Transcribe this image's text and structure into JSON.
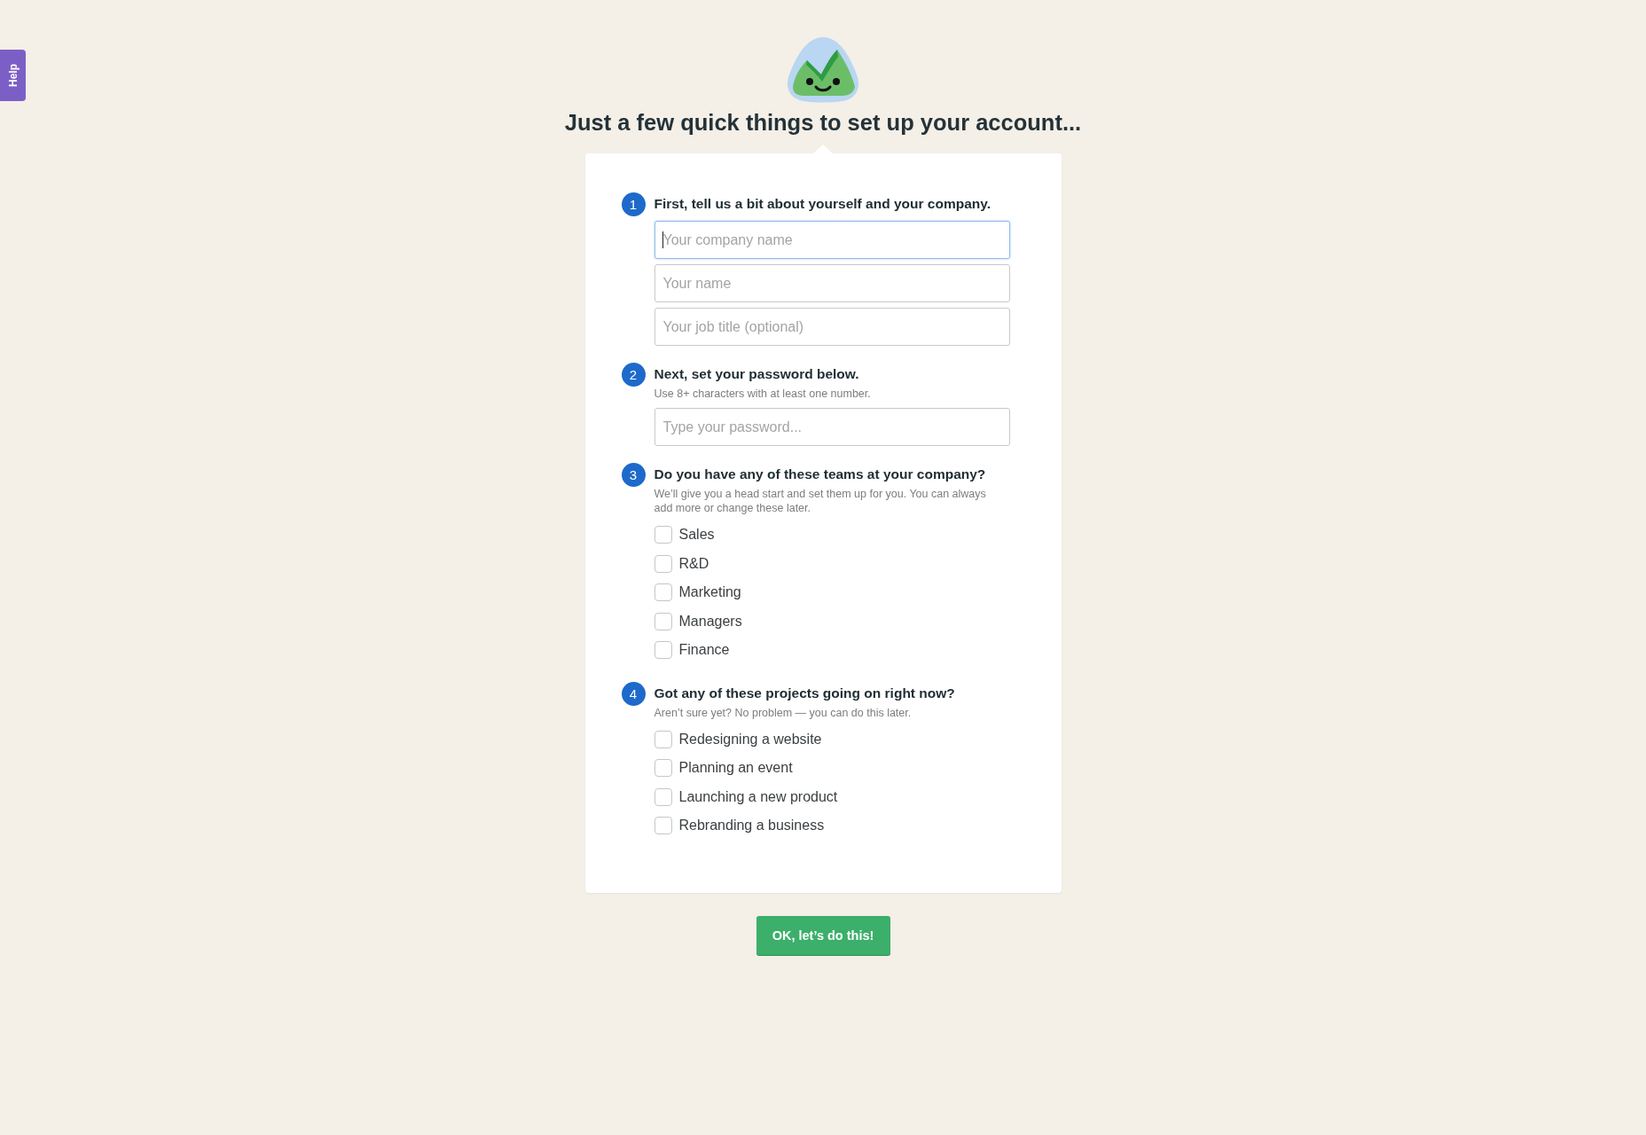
{
  "help_tab": {
    "label": "Help"
  },
  "title": "Just a few quick things to set up your account...",
  "steps": [
    {
      "number": "1",
      "kind": "fields",
      "heading": "First, tell us a bit about yourself and your company.",
      "fields": [
        {
          "placeholder": "Your company name",
          "focused": true
        },
        {
          "placeholder": "Your name",
          "focused": false
        },
        {
          "placeholder": "Your job title (optional)",
          "focused": false
        }
      ]
    },
    {
      "number": "2",
      "kind": "fields",
      "heading": "Next, set your password below.",
      "hint": "Use 8+ characters with at least one number.",
      "fields": [
        {
          "placeholder": "Type your password...",
          "focused": false
        }
      ]
    },
    {
      "number": "3",
      "kind": "checklist",
      "heading": "Do you have any of these teams at your company?",
      "hint": "We’ll give you a head start and set them up for you. You can always add more or change these later.",
      "options": [
        {
          "label": "Sales",
          "checked": false
        },
        {
          "label": "R&D",
          "checked": false
        },
        {
          "label": "Marketing",
          "checked": false
        },
        {
          "label": "Managers",
          "checked": false
        },
        {
          "label": "Finance",
          "checked": false
        }
      ]
    },
    {
      "number": "4",
      "kind": "checklist",
      "heading": "Got any of these projects going on right now?",
      "hint": "Aren’t sure yet? No problem — you can do this later.",
      "options": [
        {
          "label": "Redesigning a website",
          "checked": false
        },
        {
          "label": "Planning an event",
          "checked": false
        },
        {
          "label": "Launching a new product",
          "checked": false
        },
        {
          "label": "Rebranding a business",
          "checked": false
        }
      ]
    }
  ],
  "submit_button": {
    "label": "OK, let’s do this!"
  }
}
